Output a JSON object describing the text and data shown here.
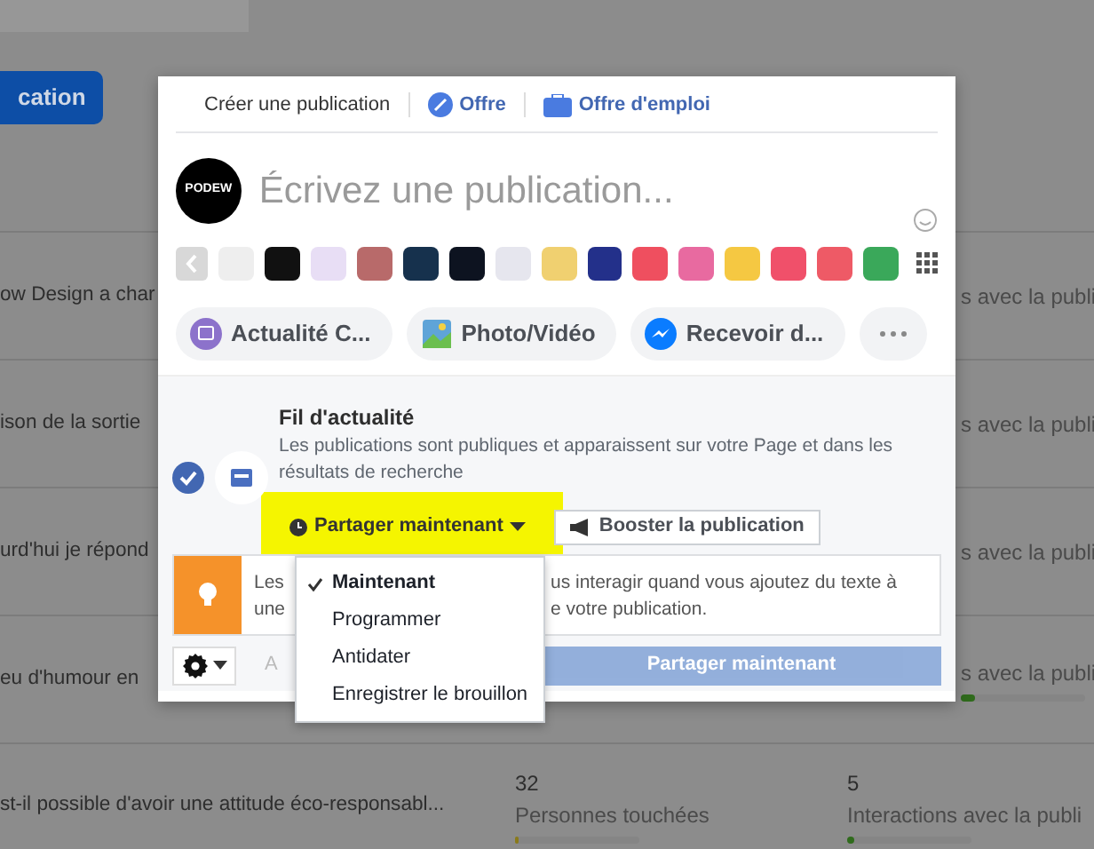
{
  "background_page": {
    "top_button": "cation",
    "rows": [
      {
        "title": "ow Design a char",
        "interactions": "s avec la publi"
      },
      {
        "title": "ison de la sortie",
        "interactions": "s avec la publi"
      },
      {
        "title": "urd'hui je répond",
        "interactions": "s avec la publi"
      },
      {
        "title": "eu d'humour en",
        "interactions": "s avec la publi",
        "interactions_bar": {
          "level": 0.12
        }
      },
      {
        "title": "st-il possible d'avoir une attitude éco-responsabl...",
        "reach_value": "32",
        "reach_label": "Personnes touchées",
        "reach_bar": {
          "level": 0.03
        },
        "interactions_value": "5",
        "interactions": "Interactions avec la publi",
        "interactions_bar": {
          "level": 0.05
        }
      }
    ]
  },
  "composer": {
    "tabs": [
      {
        "label": "Créer une publication",
        "selected": true,
        "kind": "plain"
      },
      {
        "label": "Offre",
        "selected": false,
        "kind": "offer"
      },
      {
        "label": "Offre d'emploi",
        "selected": false,
        "kind": "job"
      }
    ],
    "avatar": "PODEW",
    "placeholder": "Écrivez une publication...",
    "backgrounds": [
      {
        "color": "#eeeeee"
      },
      {
        "color": "#111111"
      },
      {
        "color": "#e8def5"
      },
      {
        "color": "#b86a6a"
      },
      {
        "color": "#16314d"
      },
      {
        "color": "#0d1320"
      },
      {
        "color": "#e6e6ee"
      },
      {
        "color": "#f0d070"
      },
      {
        "color": "#23308a"
      },
      {
        "color": "#ef4f5f"
      },
      {
        "color": "#e86aa0"
      },
      {
        "color": "#f5c842"
      },
      {
        "color": "#f0506a"
      },
      {
        "color": "#ee5a66"
      },
      {
        "color": "#3aa85a"
      }
    ],
    "actions": [
      {
        "label": "Actualité C...",
        "kind": "story"
      },
      {
        "label": "Photo/Vidéo",
        "kind": "photo"
      },
      {
        "label": "Recevoir d...",
        "kind": "messenger"
      }
    ],
    "audience": {
      "title": "Fil d'actualité",
      "description": "Les publications sont publiques et apparaissent sur votre Page et dans les résultats de recherche",
      "checked": true
    },
    "share_button": "Partager maintenant",
    "boost_button": "Booster la publication",
    "tip_left": [
      "Les",
      "une"
    ],
    "tip_right": [
      "us interagir quand vous ajoutez du texte à",
      "e votre publication."
    ],
    "preview_partial": "A",
    "submit_button": {
      "label": "Partager maintenant",
      "disabled": true
    },
    "share_menu": [
      {
        "label": "Maintenant",
        "selected": true
      },
      {
        "label": "Programmer",
        "selected": false
      },
      {
        "label": "Antidater",
        "selected": false
      },
      {
        "label": "Enregistrer le brouillon",
        "selected": false
      }
    ]
  }
}
